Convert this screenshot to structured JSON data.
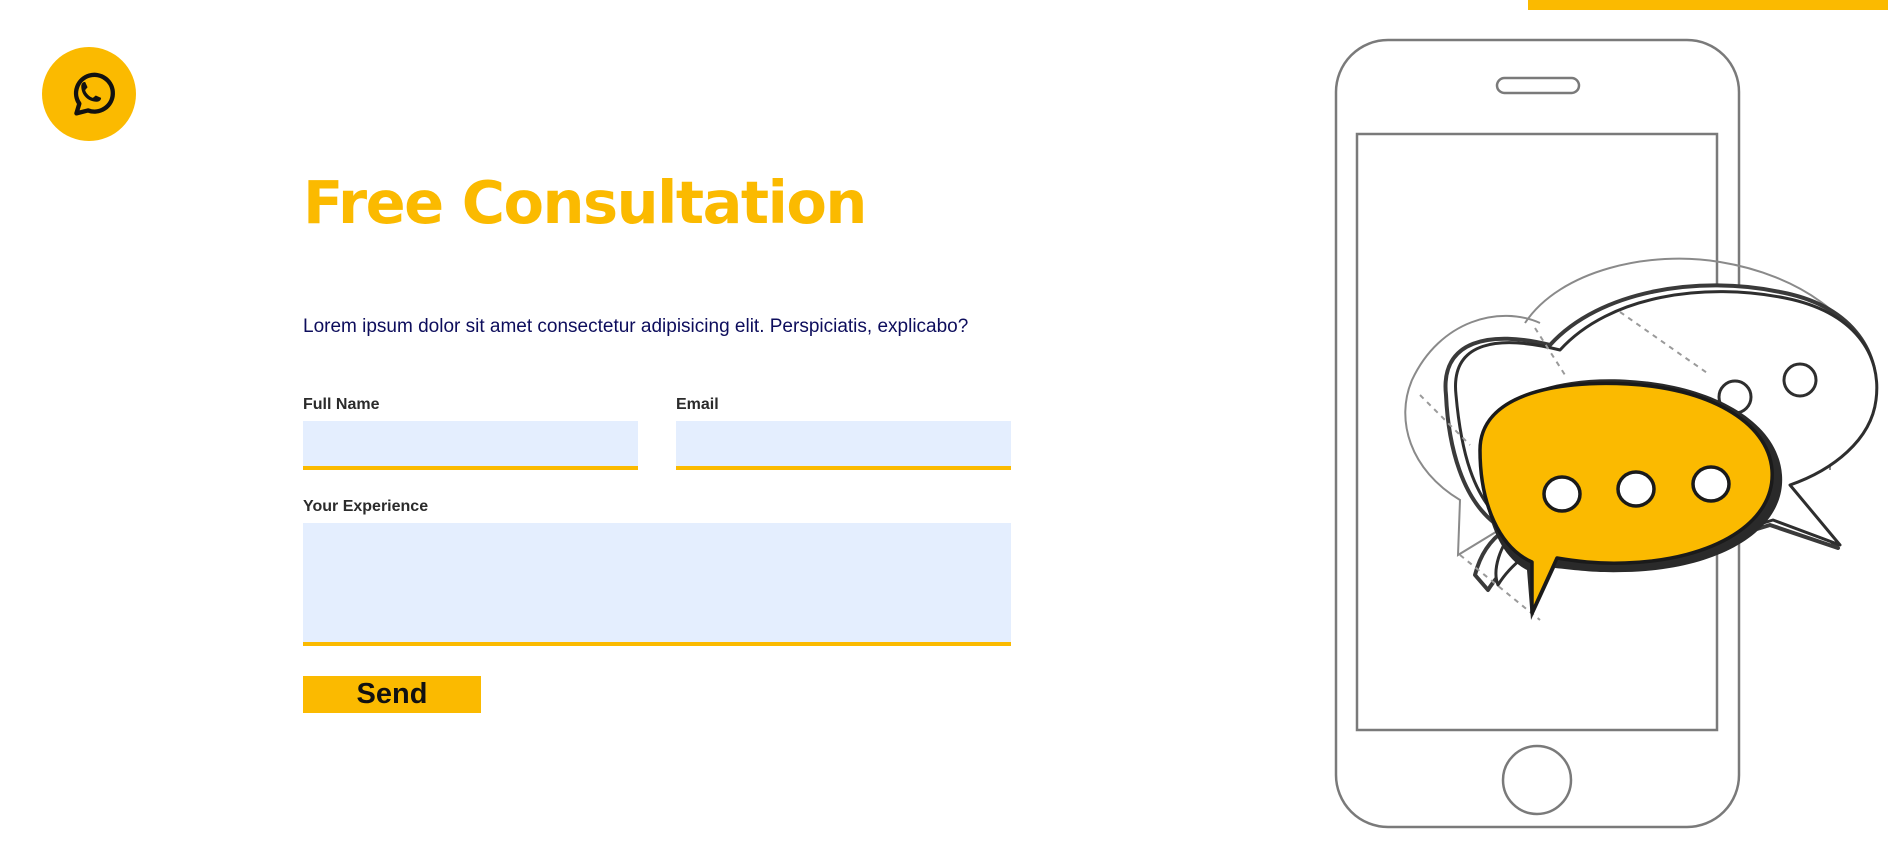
{
  "header": {
    "whatsapp_icon": "whatsapp-icon"
  },
  "form": {
    "title": "Free Consultation",
    "description": "Lorem ipsum dolor sit amet consectetur adipisicing elit. Perspiciatis, explicabo?",
    "full_name": {
      "label": "Full Name",
      "value": "",
      "placeholder": ""
    },
    "email": {
      "label": "Email",
      "value": "",
      "placeholder": ""
    },
    "experience": {
      "label": "Your Experience",
      "value": "",
      "placeholder": ""
    },
    "send_label": "Send"
  },
  "illustration": {
    "name": "phone-with-chat-bubbles"
  },
  "colors": {
    "accent": "#FBBA00",
    "field_background": "#E4EEFE",
    "description_text": "#0d0d5c",
    "label_text": "#2b2b2b"
  }
}
